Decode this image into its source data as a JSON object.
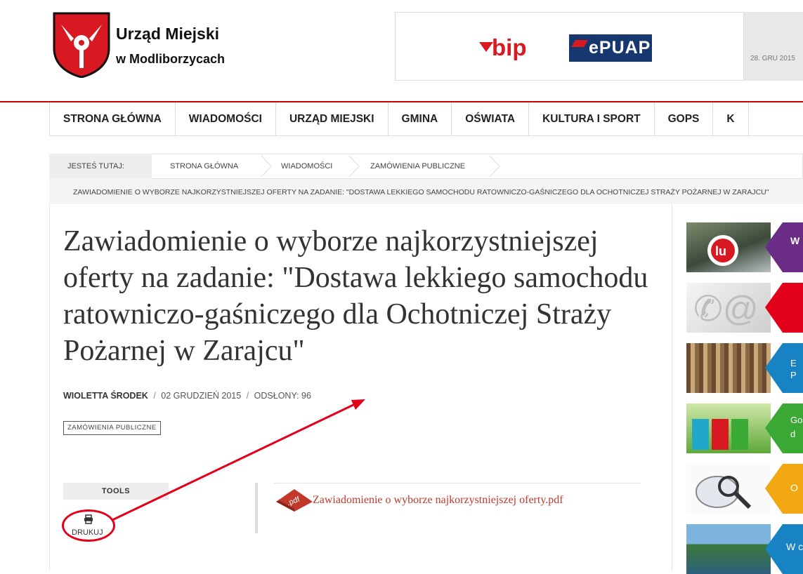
{
  "header": {
    "logo_title": "Urząd Miejski",
    "logo_subtitle": "w Modliborzycach",
    "bip_label": "bip",
    "epuap_label": "ePUAP",
    "date": "28. GRU 2015"
  },
  "nav": {
    "items": [
      "STRONA GŁÓWNA",
      "WIADOMOŚCI",
      "URZĄD MIEJSKI",
      "GMINA",
      "OŚWIATA",
      "KULTURA I SPORT",
      "GOPS",
      "K"
    ]
  },
  "breadcrumb": {
    "here_label": "JESTEŚ TUTAJ:",
    "items": [
      "STRONA GŁÓWNA",
      "WIADOMOŚCI",
      "ZAMÓWIENIA PUBLICZNE"
    ],
    "current": "ZAWIADOMIENIE O WYBORZE NAJKORZYSTNIEJSZEJ OFERTY NA ZADANIE: \"DOSTAWA LEKKIEGO SAMOCHODU RATOWNICZO-GAŚNICZEGO DLA OCHOTNICZEJ STRAŻY POŻARNEJ W ZARAJCU\""
  },
  "article": {
    "title": "Zawiadomienie o wyborze najkorzystniejszej oferty na zadanie: \"Dostawa lekkiego samochodu ratowniczo-gaśniczego dla Ochotniczej Straży Pożarnej w Zarajcu\"",
    "author": "WIOLETTA ŚRODEK",
    "date": "02 GRUDZIEŃ 2015",
    "views_label": "ODSŁONY: 96",
    "sep": "/",
    "tag": "ZAMÓWIENIA PUBLICZNE"
  },
  "tools": {
    "heading": "TOOLS",
    "print_label": "DRUKUJ"
  },
  "attachment": {
    "icon_text": ".pdf",
    "link_text": "Zawiadomienie o wyborze najkorzystniejszej oferty.pdf"
  },
  "sidebar": {
    "banners": [
      {
        "text": "W",
        "badge": "lu",
        "color": "#6a2c84"
      },
      {
        "text": "",
        "color": "#e3001b"
      },
      {
        "text": "E\nP",
        "color": "#1783c4"
      },
      {
        "text": "Go\nd",
        "color": "#3aa935"
      },
      {
        "text": "O",
        "color": "#f3a712"
      },
      {
        "text": "W c",
        "color": "#1783c4"
      }
    ]
  },
  "colors": {
    "accent": "#c00",
    "annotation": "#e3001b",
    "link": "#c0392b"
  }
}
